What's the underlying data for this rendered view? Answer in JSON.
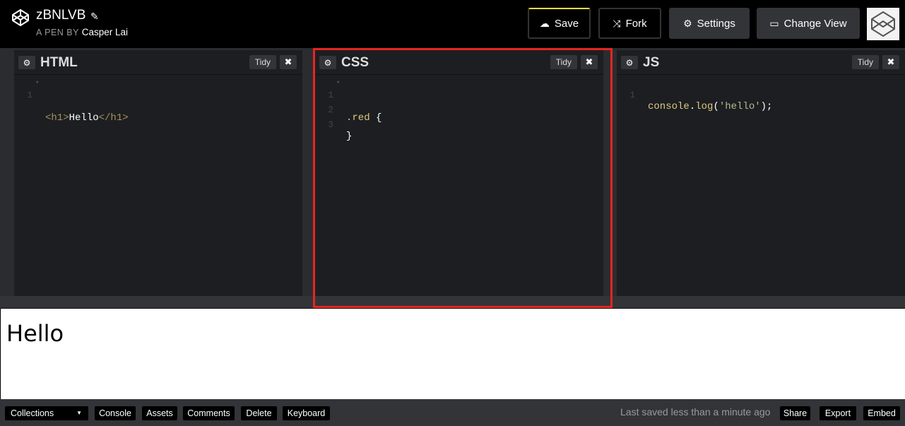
{
  "header": {
    "pen_title": "zBNLVB",
    "byline_prefix": "A PEN BY",
    "author": "Casper Lai",
    "buttons": {
      "save": "Save",
      "fork": "Fork",
      "settings": "Settings",
      "change_view": "Change View"
    }
  },
  "editors": {
    "html": {
      "title": "HTML",
      "tidy": "Tidy",
      "lines": [
        {
          "n": "1",
          "open": "<h1>",
          "text": "Hello",
          "close": "</h1>"
        }
      ]
    },
    "css": {
      "title": "CSS",
      "tidy": "Tidy",
      "lines": [
        {
          "n": "1",
          "selector": ".red",
          "brace": " {"
        },
        {
          "n": "2",
          "text": ""
        },
        {
          "n": "3",
          "text": "}"
        }
      ]
    },
    "js": {
      "title": "JS",
      "tidy": "Tidy",
      "lines": [
        {
          "n": "1",
          "obj": "console",
          "dot": ".",
          "fn": "log",
          "open": "(",
          "str": "'hello'",
          "close": ");"
        }
      ]
    }
  },
  "preview": {
    "heading": "Hello"
  },
  "footer": {
    "collections": "Collections",
    "console": "Console",
    "assets": "Assets",
    "comments": "Comments",
    "delete": "Delete",
    "keyboard": "Keyboard",
    "status": "Last saved less than a minute ago",
    "share": "Share",
    "export": "Export",
    "embed": "Embed"
  },
  "colors": {
    "accent_save": "#ffdd40",
    "highlight_box": "#e8251f"
  }
}
